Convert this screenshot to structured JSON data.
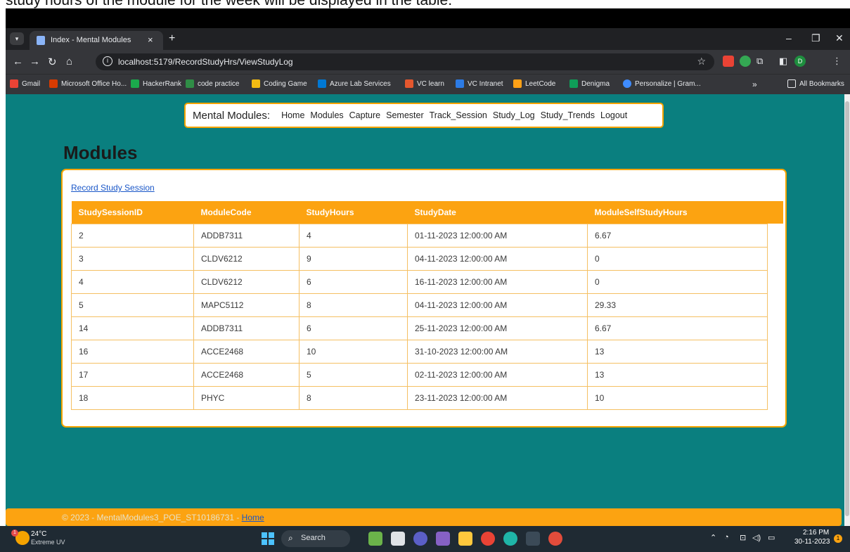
{
  "caption": "study hours of the module for the week will be displayed in the table.",
  "browser": {
    "tab_title": "Index - Mental Modules",
    "url": "localhost:5179/RecordStudyHrs/ViewStudyLog",
    "bookmarks": [
      {
        "label": "Gmail",
        "color": "#ea4335"
      },
      {
        "label": "Microsoft Office Ho...",
        "color": "#d83b01"
      },
      {
        "label": "HackerRank",
        "color": "#1ba94c"
      },
      {
        "label": "code practice",
        "color": "#2f8d46"
      },
      {
        "label": "Coding Game",
        "color": "#f2bb13"
      },
      {
        "label": "Azure Lab Services",
        "color": "#0078d4"
      },
      {
        "label": "VC learn",
        "color": "#e4572e"
      },
      {
        "label": "VC Intranet",
        "color": "#2c7be5"
      },
      {
        "label": "LeetCode",
        "color": "#ffa116"
      },
      {
        "label": "Denigma",
        "color": "#0f9d58"
      },
      {
        "label": "Personalize | Gram...",
        "color": "#3f8cff"
      }
    ],
    "all_bookmarks": "All Bookmarks",
    "profile_letter": "D"
  },
  "nav": {
    "brand": "Mental Modules:",
    "links": [
      "Home",
      "Modules",
      "Capture",
      "Semester",
      "Track_Session",
      "Study_Log",
      "Study_Trends",
      "Logout"
    ]
  },
  "page": {
    "heading": "Modules",
    "record_link": "Record Study Session"
  },
  "table": {
    "columns": [
      "StudySessionID",
      "ModuleCode",
      "StudyHours",
      "StudyDate",
      "ModuleSelfStudyHours"
    ],
    "rows": [
      [
        "2",
        "ADDB7311",
        "4",
        "01-11-2023 12:00:00 AM",
        "6.67"
      ],
      [
        "3",
        "CLDV6212",
        "9",
        "04-11-2023 12:00:00 AM",
        "0"
      ],
      [
        "4",
        "CLDV6212",
        "6",
        "16-11-2023 12:00:00 AM",
        "0"
      ],
      [
        "5",
        "MAPC5112",
        "8",
        "04-11-2023 12:00:00 AM",
        "29.33"
      ],
      [
        "14",
        "ADDB7311",
        "6",
        "25-11-2023 12:00:00 AM",
        "6.67"
      ],
      [
        "16",
        "ACCE2468",
        "10",
        "31-10-2023 12:00:00 AM",
        "13"
      ],
      [
        "17",
        "ACCE2468",
        "5",
        "02-11-2023 12:00:00 AM",
        "13"
      ],
      [
        "18",
        "PHYC",
        "8",
        "23-11-2023 12:00:00 AM",
        "10"
      ]
    ]
  },
  "footer": {
    "text": "© 2023 - MentalModules3_POE_ST10186731 - ",
    "link": "Home"
  },
  "taskbar": {
    "temperature": "24°C",
    "weather": "Extreme UV",
    "weather_badge": "1",
    "search": "Search",
    "time": "2:16 PM",
    "date": "30-11-2023",
    "notification_count": "1"
  },
  "colors": {
    "page_bg": "#0a7f7f",
    "accent": "#fca311",
    "link": "#1a57c8"
  }
}
